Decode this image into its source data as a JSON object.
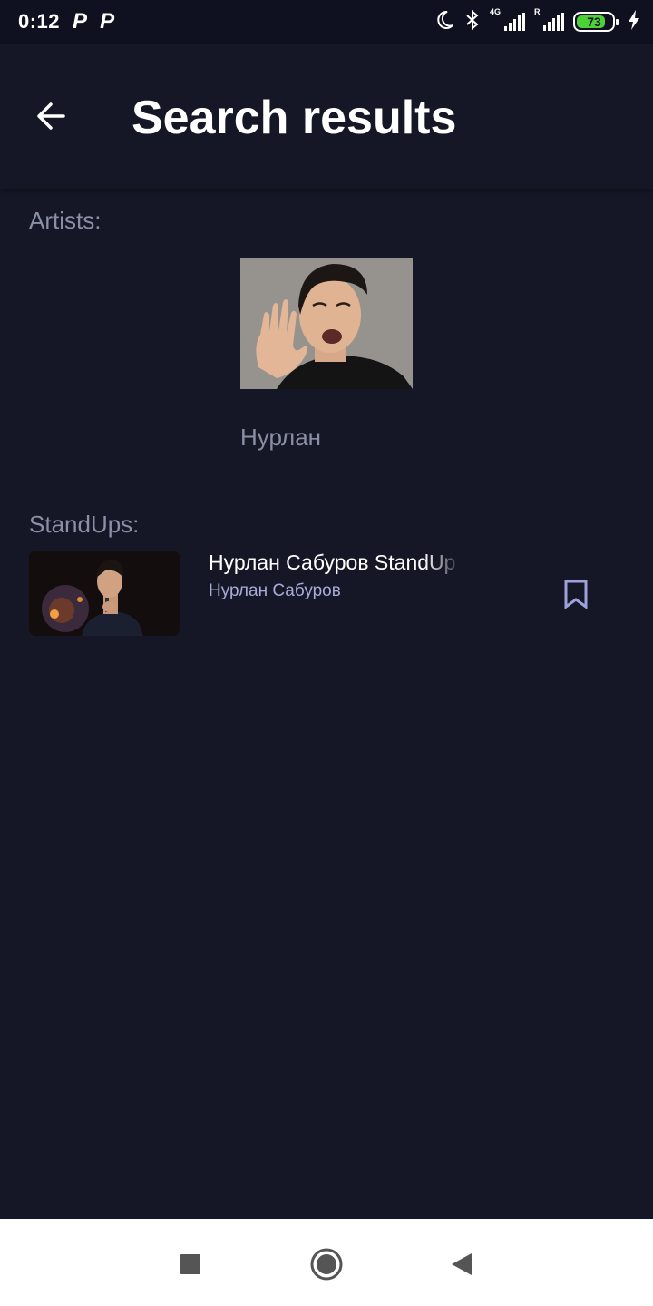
{
  "status_bar": {
    "time": "0:12",
    "notifications": [
      "P",
      "P"
    ],
    "network_label_1": "4G",
    "network_label_2": "R",
    "battery_percent": "73",
    "icons": [
      "moon-icon",
      "bluetooth-icon",
      "signal-4g-icon",
      "signal-roaming-icon",
      "battery-icon",
      "charging-icon"
    ]
  },
  "app_bar": {
    "title": "Search results",
    "back_icon": "arrow-left-icon"
  },
  "artists": {
    "label": "Artists:",
    "items": [
      {
        "name": "Нурлан"
      }
    ]
  },
  "standups": {
    "label": "StandUps:",
    "items": [
      {
        "title": "Нурлан Сабуров StandUp",
        "subtitle": "Нурлан Сабуров",
        "bookmark_icon": "bookmark-icon"
      }
    ]
  },
  "nav_bar": {
    "icons": [
      "recents-square-icon",
      "home-circle-icon",
      "back-triangle-icon"
    ]
  },
  "colors": {
    "background": "#151727",
    "status_bar": "#0f1120",
    "secondary_text": "#8b8fa5",
    "subtitle_text": "#a7abd6",
    "battery_green": "#4cd137"
  }
}
